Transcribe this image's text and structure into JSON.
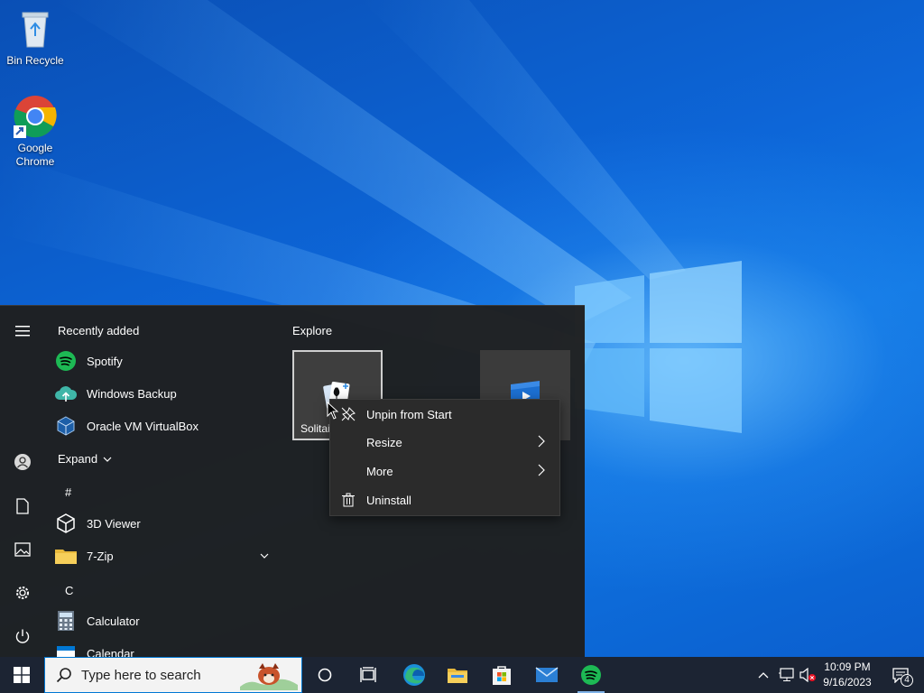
{
  "desktop": {
    "icons": [
      {
        "label": "Bin Recycle",
        "icon": "recycle-bin-icon"
      },
      {
        "label": "Google Chrome",
        "icon": "chrome-icon"
      }
    ]
  },
  "start_menu": {
    "recently_added_heading": "Recently added",
    "recent_apps": [
      {
        "label": "Spotify",
        "icon": "spotify-icon"
      },
      {
        "label": "Windows Backup",
        "icon": "backup-cloud-icon"
      },
      {
        "label": "Oracle VM VirtualBox",
        "icon": "virtualbox-icon"
      }
    ],
    "expand_label": "Expand",
    "groups": [
      {
        "letter": "#",
        "apps": [
          {
            "label": "3D Viewer",
            "icon": "cube-icon"
          },
          {
            "label": "7-Zip",
            "icon": "folder-icon",
            "expandable": true
          }
        ]
      },
      {
        "letter": "C",
        "apps": [
          {
            "label": "Calculator",
            "icon": "calculator-icon"
          },
          {
            "label": "Calendar",
            "icon": "calendar-icon"
          }
        ]
      }
    ],
    "tiles_heading": "Explore",
    "tiles": [
      {
        "label": "Solitaire",
        "icon": "solitaire-icon"
      },
      {
        "label": "",
        "icon": "movies-icon"
      }
    ],
    "rail_icons": [
      "hamburger-icon",
      "user-icon",
      "document-icon",
      "pictures-icon",
      "gear-icon",
      "power-icon"
    ]
  },
  "context_menu": {
    "items": [
      {
        "label": "Unpin from Start",
        "icon": "unpin-icon",
        "submenu": false
      },
      {
        "label": "Resize",
        "icon": "",
        "submenu": true
      },
      {
        "label": "More",
        "icon": "",
        "submenu": true
      },
      {
        "label": "Uninstall",
        "icon": "trash-icon",
        "submenu": false
      }
    ]
  },
  "taskbar": {
    "search_placeholder": "Type here to search",
    "pinned": [
      "cortana-icon",
      "task-view-icon",
      "edge-icon",
      "file-explorer-icon",
      "store-icon",
      "mail-icon",
      "spotify-icon"
    ],
    "clock_time": "10:09 PM",
    "clock_date": "9/16/2023",
    "notification_count": "4"
  },
  "colors": {
    "accent": "#0078d4",
    "start_bg": "#1f1f1f",
    "taskbar_bg": "#1c2433",
    "spotify": "#1db954"
  }
}
